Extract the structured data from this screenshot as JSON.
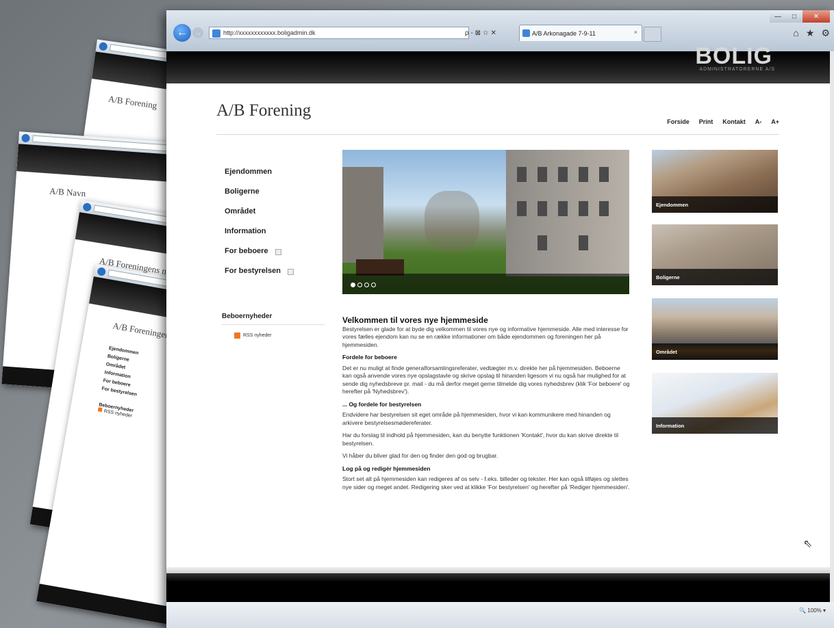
{
  "background_pages": [
    {
      "title": "A/B Forening"
    },
    {
      "title": "A/B Navn"
    },
    {
      "title": "A/B Foreningens n"
    },
    {
      "title": "A/B Foreningens"
    }
  ],
  "browser": {
    "address": "http://xxxxxxxxxxxx.boligadmin.dk",
    "address_controls": "ρ - ⊠ ☆ ✕",
    "tab_title": "A/B Arkonagade 7-9-11",
    "tab_close": "×",
    "win_min": "—",
    "win_max": "□",
    "win_close": "✕",
    "tool_home": "⌂",
    "tool_star": "★",
    "tool_gear": "⚙",
    "back_glyph": "←",
    "fwd_glyph": "→",
    "zoom": "🔍 100%  ▾"
  },
  "site": {
    "logo": "BOLIG",
    "logo_sub": "ADMINISTRATORERNE A/S",
    "title": "A/B Forening",
    "top_nav": [
      "Forside",
      "Print",
      "Kontakt",
      "A-",
      "A+"
    ],
    "side_nav": [
      {
        "label": "Ejendommen",
        "expand": false
      },
      {
        "label": "Boligerne",
        "expand": false
      },
      {
        "label": "Området",
        "expand": false
      },
      {
        "label": "Information",
        "expand": false
      },
      {
        "label": "For beboere",
        "expand": true
      },
      {
        "label": "For bestyrelsen",
        "expand": true
      }
    ],
    "news_heading": "Beboernyheder",
    "rss_label": "RSS nyheder",
    "slider_dots": 4,
    "slider_active": 1,
    "content": {
      "heading": "Velkommen til vores nye hjemmeside",
      "intro": "Bestyrelsen er glade for at byde dig velkommen til vores nye og informative hjemmeside. Alle med interesse for vores fælles ejendom kan nu se en række informationer om både ejendommen og foreningen her på hjemmesiden.",
      "h2_1": "Fordele for beboere",
      "p1": "Det er nu muligt at finde generalforsamlingsreferater, vedtægter m.v. direkte her på hjemmesiden. Beboerne kan også anvende vores nye opslagstavle og skrive opslag til hinanden ligesom vi nu også har mulighed for at sende dig nyhedsbreve pr. mail - du må derfor meget gerne tilmelde dig vores nyhedsbrev (klik 'For beboere' og herefter på 'Nyhedsbrev').",
      "h2_2": "... Og fordele for bestyrelsen",
      "p2": "Endvidere har bestyrelsen sit eget område på hjemmesiden, hvor vi kan kommunikere med hinanden og arkivere bestyrelsesmødereferater.",
      "p3": "Har du forslag til indhold på hjemmesiden, kan du benytte funktionen 'Kontakt', hvor du kan skrive direkte til bestyrelsen.",
      "p4": "Vi håber du bliver glad for den og finder den god og brugbar.",
      "h2_3": "Log på og redigér hjemmesiden",
      "p5": "Stort set alt på hjemmesiden kan redigeres af os selv - f.eks. billeder og tekster. Her kan også tilføjes og slettes nye sider og meget andet. Redigering sker ved at klikke 'For bestyrelsen' og herefter på 'Rediger hjemmesiden'."
    },
    "tiles": [
      {
        "label": "Ejendommen"
      },
      {
        "label": "Boligerne"
      },
      {
        "label": "Området"
      },
      {
        "label": "Information"
      }
    ]
  }
}
